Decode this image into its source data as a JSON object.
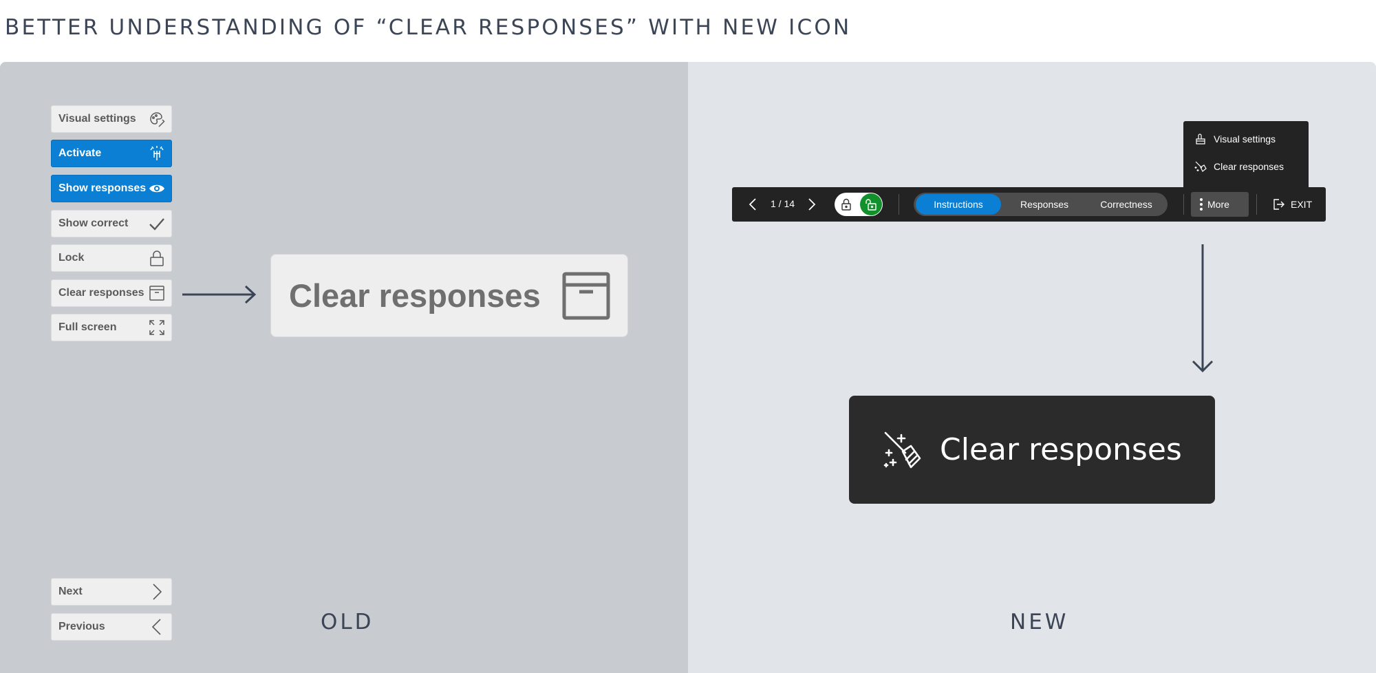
{
  "page": {
    "title": "BETTER UNDERSTANDING OF “CLEAR RESPONSES” WITH NEW ICON"
  },
  "old_panel": {
    "caption": "OLD",
    "sidebar_buttons": [
      {
        "label": "Visual settings",
        "icon": "palette-icon",
        "active": false
      },
      {
        "label": "Activate",
        "icon": "activate-icon",
        "active": true
      },
      {
        "label": "Show responses",
        "icon": "eye-icon",
        "active": true
      },
      {
        "label": "Show correct",
        "icon": "checkmark-icon",
        "active": false
      },
      {
        "label": "Lock",
        "icon": "lock-icon",
        "active": false
      },
      {
        "label": "Clear responses",
        "icon": "archive-box-icon",
        "active": false
      },
      {
        "label": "Full screen",
        "icon": "fullscreen-icon",
        "active": false
      }
    ],
    "nav_buttons": [
      {
        "label": "Next",
        "icon": "chevron-right-icon"
      },
      {
        "label": "Previous",
        "icon": "chevron-left-icon"
      }
    ],
    "large_button": {
      "label": "Clear responses",
      "icon": "archive-box-icon"
    }
  },
  "new_panel": {
    "caption": "NEW",
    "toolbar": {
      "pager": "1 / 14",
      "tabs": [
        {
          "label": "Instructions",
          "selected": true
        },
        {
          "label": "Responses",
          "selected": false
        },
        {
          "label": "Correctness",
          "selected": false
        }
      ],
      "more_label": "More",
      "exit_label": "EXIT"
    },
    "more_menu": [
      {
        "label": "Visual settings",
        "icon": "paint-bucket-icon"
      },
      {
        "label": "Clear responses",
        "icon": "broom-sparkles-icon"
      }
    ],
    "large_button": {
      "label": "Clear responses",
      "icon": "broom-sparkles-icon"
    }
  },
  "colors": {
    "old_bg": "#c8cbd0",
    "new_bg": "#e1e4e9",
    "accent_blue": "#0a7fd4",
    "lock_green": "#12902c",
    "toolbar_bg": "#232323"
  }
}
